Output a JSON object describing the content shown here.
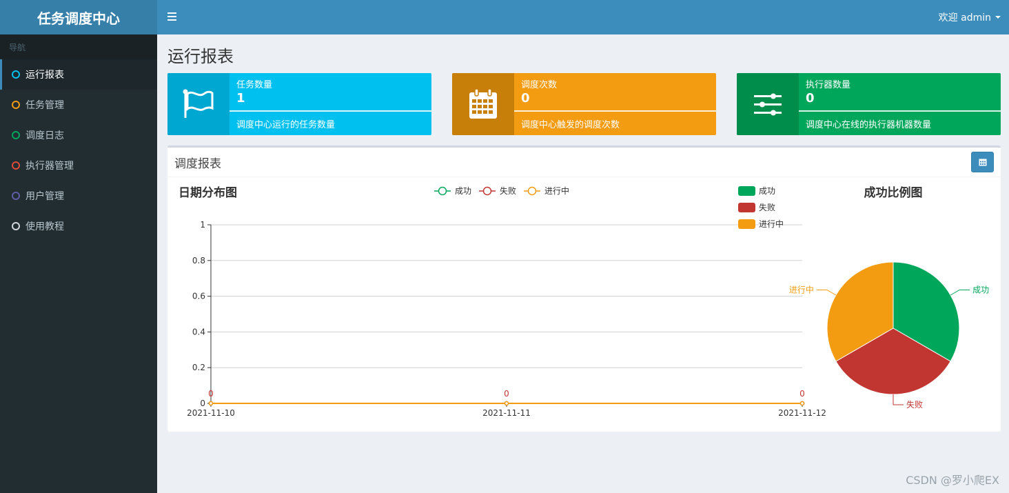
{
  "app": {
    "logo": "任务调度中心"
  },
  "header": {
    "user_menu": "欢迎 admin"
  },
  "sidebar": {
    "header": "导航",
    "items": [
      {
        "label": "运行报表",
        "icon": "circle-icon",
        "color": "#00c0ef"
      },
      {
        "label": "任务管理",
        "icon": "circle-icon",
        "color": "#f39c12"
      },
      {
        "label": "调度日志",
        "icon": "circle-icon",
        "color": "#00a65a"
      },
      {
        "label": "执行器管理",
        "icon": "circle-icon",
        "color": "#dd4b39"
      },
      {
        "label": "用户管理",
        "icon": "circle-icon",
        "color": "#605ca8"
      },
      {
        "label": "使用教程",
        "icon": "circle-icon",
        "color": "#d2d6de"
      }
    ]
  },
  "page": {
    "title": "运行报表"
  },
  "info_boxes": [
    {
      "label": "任务数量",
      "number": "1",
      "desc": "调度中心运行的任务数量",
      "icon": "flag-icon",
      "color": "#00c0ef",
      "icon_bg": "#00a7d0"
    },
    {
      "label": "调度次数",
      "number": "0",
      "desc": "调度中心触发的调度次数",
      "icon": "calendar-icon",
      "color": "#f39c12",
      "icon_bg": "#c87f0a"
    },
    {
      "label": "执行器数量",
      "number": "0",
      "desc": "调度中心在线的执行器机器数量",
      "icon": "sliders-icon",
      "color": "#00a65a",
      "icon_bg": "#008d4c"
    }
  ],
  "report": {
    "title": "调度报表",
    "tool_icon": "calendar-icon"
  },
  "chart_data": [
    {
      "type": "line",
      "title": "日期分布图",
      "categories": [
        "2021-11-10",
        "2021-11-11",
        "2021-11-12"
      ],
      "series": [
        {
          "name": "成功",
          "values": [
            0,
            0,
            0
          ],
          "color": "#00a65a"
        },
        {
          "name": "失败",
          "values": [
            0,
            0,
            0
          ],
          "color": "#c23632"
        },
        {
          "name": "进行中",
          "values": [
            0,
            0,
            0
          ],
          "color": "#f39c12"
        }
      ],
      "data_labels": [
        "0",
        "0",
        "0"
      ],
      "yticks": [
        "0",
        "0.2",
        "0.4",
        "0.6",
        "0.8",
        "1"
      ],
      "ylim": [
        0,
        1
      ],
      "grid": true,
      "legend": "top-center"
    },
    {
      "type": "pie",
      "title": "成功比例图",
      "labels": [
        "成功",
        "失败",
        "进行中"
      ],
      "values": [
        1,
        1,
        1
      ],
      "colors": [
        "#00a65a",
        "#c23632",
        "#f39c12"
      ],
      "legend": "top-left"
    }
  ],
  "watermark": "CSDN @罗小爬EX"
}
